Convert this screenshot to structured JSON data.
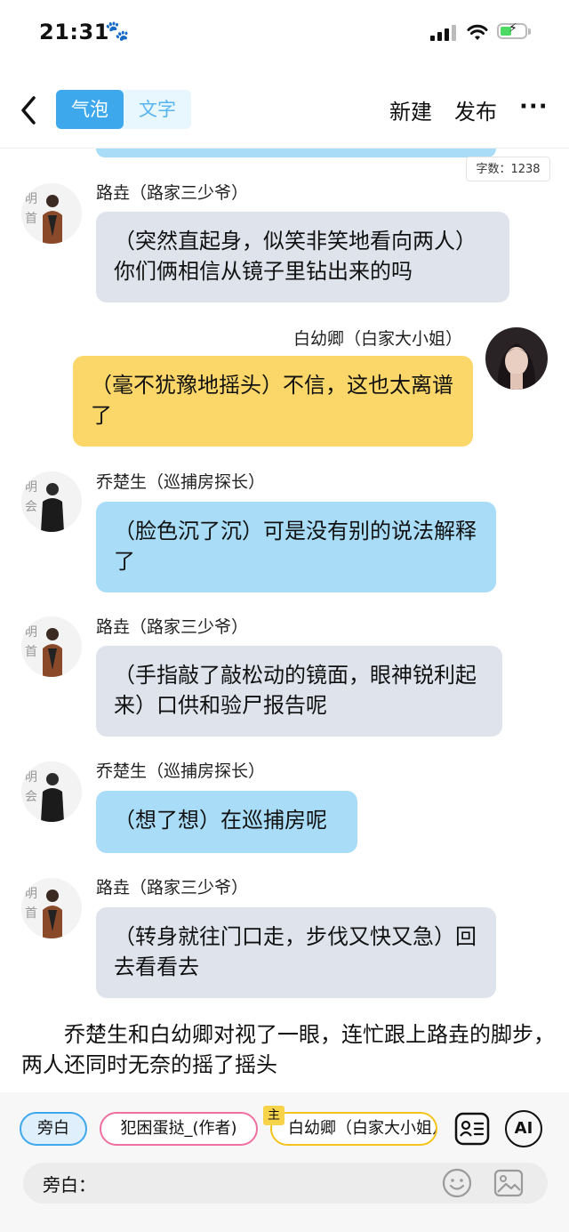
{
  "status_bar": {
    "time": "21:31",
    "paw_icon": "🐾"
  },
  "header": {
    "toggle_bubble": "气泡",
    "toggle_text": "文字",
    "new_label": "新建",
    "publish_label": "发布",
    "more_label": "···"
  },
  "word_count": "字数：1238",
  "messages": [
    {
      "speaker": "路垚（路家三少爷）",
      "text": "（突然直起身，似笑非笑地看向两人）你们俩相信从镜子里钻出来的吗",
      "side": "left",
      "color": "grey"
    },
    {
      "speaker": "白幼卿（白家大小姐）",
      "text": "（毫不犹豫地摇头）不信，这也太离谱了",
      "side": "right",
      "color": "yellow"
    },
    {
      "speaker": "乔楚生（巡捕房探长）",
      "text": "（脸色沉了沉）可是没有别的说法解释了",
      "side": "left",
      "color": "blue"
    },
    {
      "speaker": "路垚（路家三少爷）",
      "text": "（手指敲了敲松动的镜面，眼神锐利起来）口供和验尸报告呢",
      "side": "left",
      "color": "grey"
    },
    {
      "speaker": "乔楚生（巡捕房探长）",
      "text": "（想了想）在巡捕房呢",
      "side": "left",
      "color": "blue"
    },
    {
      "speaker": "路垚（路家三少爷）",
      "text": "（转身就往门口走，步伐又快又急）回去看看去",
      "side": "left",
      "color": "grey"
    }
  ],
  "narration": "乔楚生和白幼卿对视了一眼，连忙跟上路垚的脚步，两人还同时无奈的摇了摇头",
  "bottom": {
    "chips": [
      "旁白",
      "犯困蛋挞_(作者)",
      "白幼卿（白家大小姐）"
    ],
    "main_badge": "主",
    "ai_label": "AI",
    "input_label": "旁白："
  },
  "colors": {
    "accent": "#3ea8ec",
    "blue_bubble": "#a8dcf7",
    "grey_bubble": "#dfe4ec",
    "yellow_bubble": "#fbd769"
  }
}
